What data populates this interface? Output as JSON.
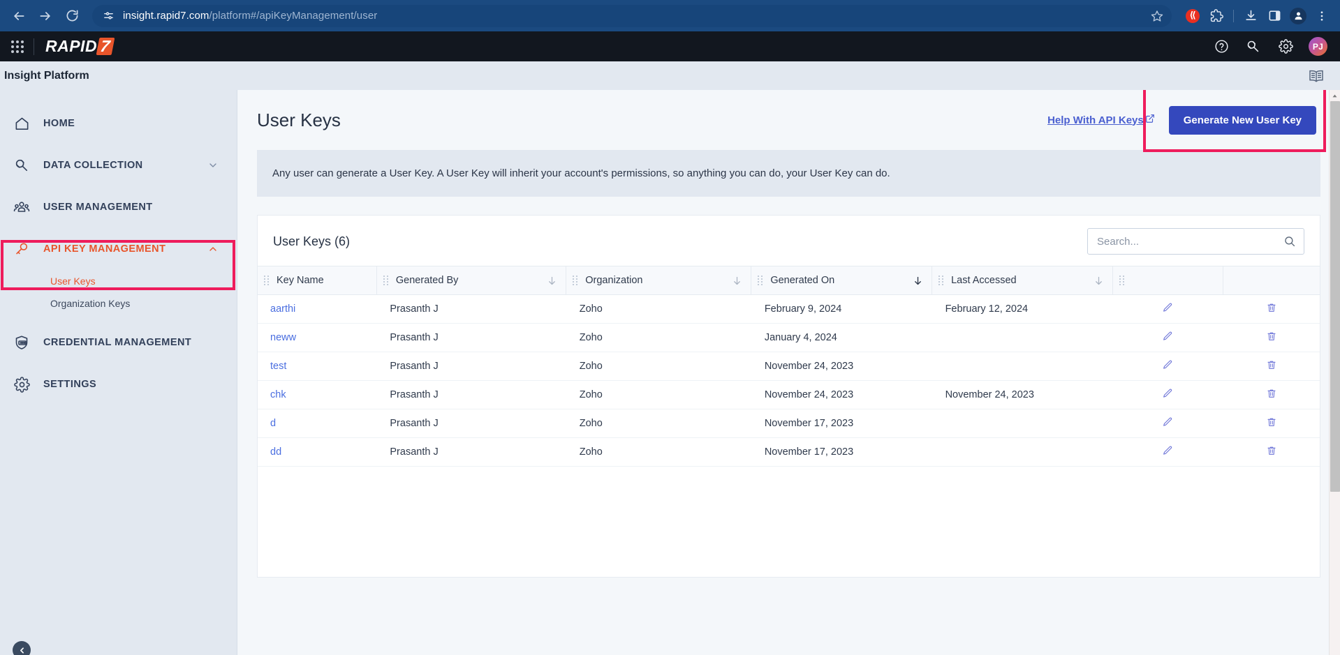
{
  "browser": {
    "back_icon": "back-arrow-icon",
    "forward_icon": "forward-arrow-icon",
    "reload_icon": "reload-icon",
    "site_info_icon": "site-settings-icon",
    "url_domain": "insight.rapid7.com",
    "url_path": "/platform#/apiKeyManagement/user",
    "url_full": "insight.rapid7.com/platform#/apiKeyManagement/user",
    "bookmark_icon": "star-icon",
    "toolbar_icons": [
      "extension-red-icon",
      "extensions-puzzle-icon",
      "downloads-icon",
      "side-panel-icon",
      "profile-avatar-icon",
      "chrome-menu-icon"
    ]
  },
  "app_header": {
    "apps_grid_icon": "apps-grid-icon",
    "logo_text": "RAPID",
    "logo_mark": "7",
    "help_icon": "help-circle-icon",
    "connectors_icon": "plug-icon",
    "settings_icon": "gear-icon",
    "avatar_initials": "PJ"
  },
  "platform_bar": {
    "title": "Insight Platform",
    "docs_icon": "open-book-icon"
  },
  "sidebar": {
    "items": [
      {
        "label": "HOME",
        "icon": "home-icon",
        "expandable": false
      },
      {
        "label": "DATA COLLECTION",
        "icon": "plug-icon",
        "expandable": true,
        "chevron": "chevron-down-icon"
      },
      {
        "label": "USER MANAGEMENT",
        "icon": "users-icon",
        "expandable": false
      },
      {
        "label": "API KEY MANAGEMENT",
        "icon": "key-icon",
        "expandable": true,
        "chevron": "chevron-up-icon",
        "active": true
      },
      {
        "label": "CREDENTIAL MANAGEMENT",
        "icon": "credential-shield-icon",
        "expandable": false
      },
      {
        "label": "SETTINGS",
        "icon": "gear-icon",
        "expandable": false
      }
    ],
    "sub_items": [
      {
        "label": "User Keys",
        "active": true
      },
      {
        "label": "Organization Keys",
        "active": false
      }
    ],
    "collapse_icon": "chevron-left-icon",
    "highlight_color": "#ee1c5c"
  },
  "main": {
    "page_title": "User Keys",
    "help_link": "Help With API Keys",
    "help_link_icon": "external-link-icon",
    "generate_button": "Generate New User Key",
    "generate_button_color": "#3448bd",
    "highlight_color": "#ee1c5c",
    "info_banner": "Any user can generate a User Key. A User Key will inherit your account's permissions, so anything you can do, your User Key can do.",
    "table_title": "User Keys (6)",
    "search": {
      "placeholder": "Search...",
      "value": "",
      "icon": "search-icon"
    }
  },
  "table": {
    "columns": [
      {
        "label": "Key Name",
        "sortable": false,
        "sort_state": "none"
      },
      {
        "label": "Generated By",
        "sortable": true,
        "sort_state": "inactive"
      },
      {
        "label": "Organization",
        "sortable": true,
        "sort_state": "inactive"
      },
      {
        "label": "Generated On",
        "sortable": true,
        "sort_state": "active"
      },
      {
        "label": "Last Accessed",
        "sortable": true,
        "sort_state": "inactive"
      }
    ],
    "sort_icon": "sort-down-arrow-icon",
    "drag_handle_icon": "drag-handle-dots-icon",
    "row_actions": [
      {
        "icon": "edit-pencil-icon",
        "name": "edit-key-button"
      },
      {
        "icon": "trash-delete-icon",
        "name": "delete-key-button"
      }
    ],
    "rows": [
      {
        "key_name": "aarthi",
        "generated_by": "Prasanth J",
        "organization": "Zoho",
        "generated_on": "February 9, 2024",
        "last_accessed": "February 12, 2024"
      },
      {
        "key_name": "neww",
        "generated_by": "Prasanth J",
        "organization": "Zoho",
        "generated_on": "January 4, 2024",
        "last_accessed": ""
      },
      {
        "key_name": "test",
        "generated_by": "Prasanth J",
        "organization": "Zoho",
        "generated_on": "November 24, 2023",
        "last_accessed": ""
      },
      {
        "key_name": "chk",
        "generated_by": "Prasanth J",
        "organization": "Zoho",
        "generated_on": "November 24, 2023",
        "last_accessed": "November 24, 2023"
      },
      {
        "key_name": "d",
        "generated_by": "Prasanth J",
        "organization": "Zoho",
        "generated_on": "November 17, 2023",
        "last_accessed": ""
      },
      {
        "key_name": "dd",
        "generated_by": "Prasanth J",
        "organization": "Zoho",
        "generated_on": "November 17, 2023",
        "last_accessed": ""
      }
    ]
  }
}
